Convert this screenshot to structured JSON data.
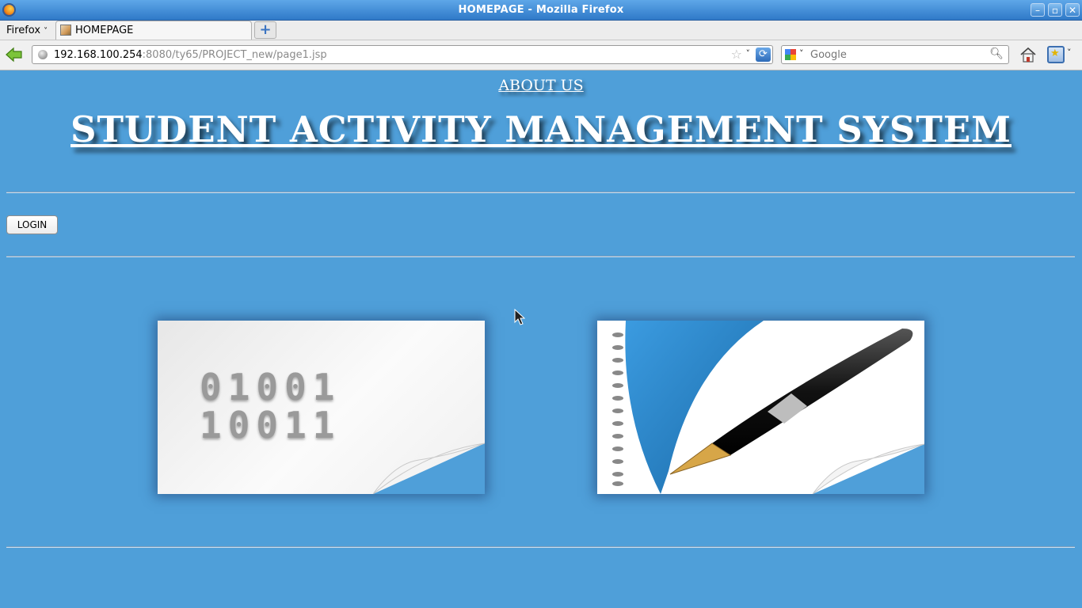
{
  "window": {
    "title": "HOMEPAGE - Mozilla Firefox"
  },
  "menu": {
    "firefox_label": "Firefox"
  },
  "tabs": [
    {
      "label": "HOMEPAGE"
    }
  ],
  "address": {
    "host": "192.168.100.254",
    "rest": ":8080/ty65/PROJECT_new/page1.jsp"
  },
  "search": {
    "placeholder": "Google"
  },
  "page": {
    "about_link": "ABOUT US",
    "title": "STUDENT ACTIVITY MANAGEMENT SYSTEM",
    "login_label": "LOGIN",
    "binary_doc": {
      "line1": "01001",
      "line2": "10011"
    }
  },
  "icons": {
    "back": "back-arrow-icon",
    "home": "home-icon",
    "bookmarks": "bookmarks-icon",
    "reload": "reload-icon",
    "search": "magnifier-icon"
  },
  "colors": {
    "page_background": "#4f9fd9",
    "titlebar": "#3d8ad6"
  }
}
